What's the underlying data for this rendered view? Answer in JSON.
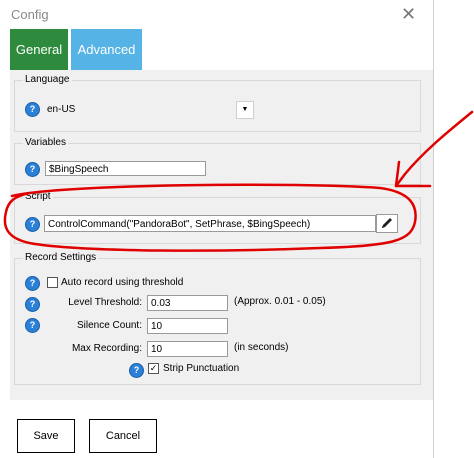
{
  "window": {
    "title": "Config"
  },
  "tabs": [
    {
      "label": "General"
    },
    {
      "label": "Advanced"
    }
  ],
  "language": {
    "legend": "Language",
    "value": "en-US"
  },
  "variables": {
    "legend": "Variables",
    "value": "$BingSpeech"
  },
  "script": {
    "legend": "Script",
    "value": "ControlCommand(\"PandoraBot\", SetPhrase, $BingSpeech)"
  },
  "record": {
    "legend": "Record Settings",
    "auto_record_label": "Auto record using threshold",
    "auto_record_checked": false,
    "level_threshold_label": "Level Threshold:",
    "level_threshold_value": "0.03",
    "level_threshold_hint": "(Approx. 0.01 - 0.05)",
    "silence_count_label": "Silence Count:",
    "silence_count_value": "10",
    "max_recording_label": "Max Recording:",
    "max_recording_value": "10",
    "max_recording_hint": "(in seconds)",
    "strip_punctuation_label": "Strip Punctuation",
    "strip_punctuation_checked": true
  },
  "buttons": {
    "save": "Save",
    "cancel": "Cancel"
  },
  "colors": {
    "general_tab": "#2e8b3e",
    "advanced_tab": "#56b3e6",
    "annotation": "#e00000",
    "help_icon": "#2a7fd6"
  }
}
